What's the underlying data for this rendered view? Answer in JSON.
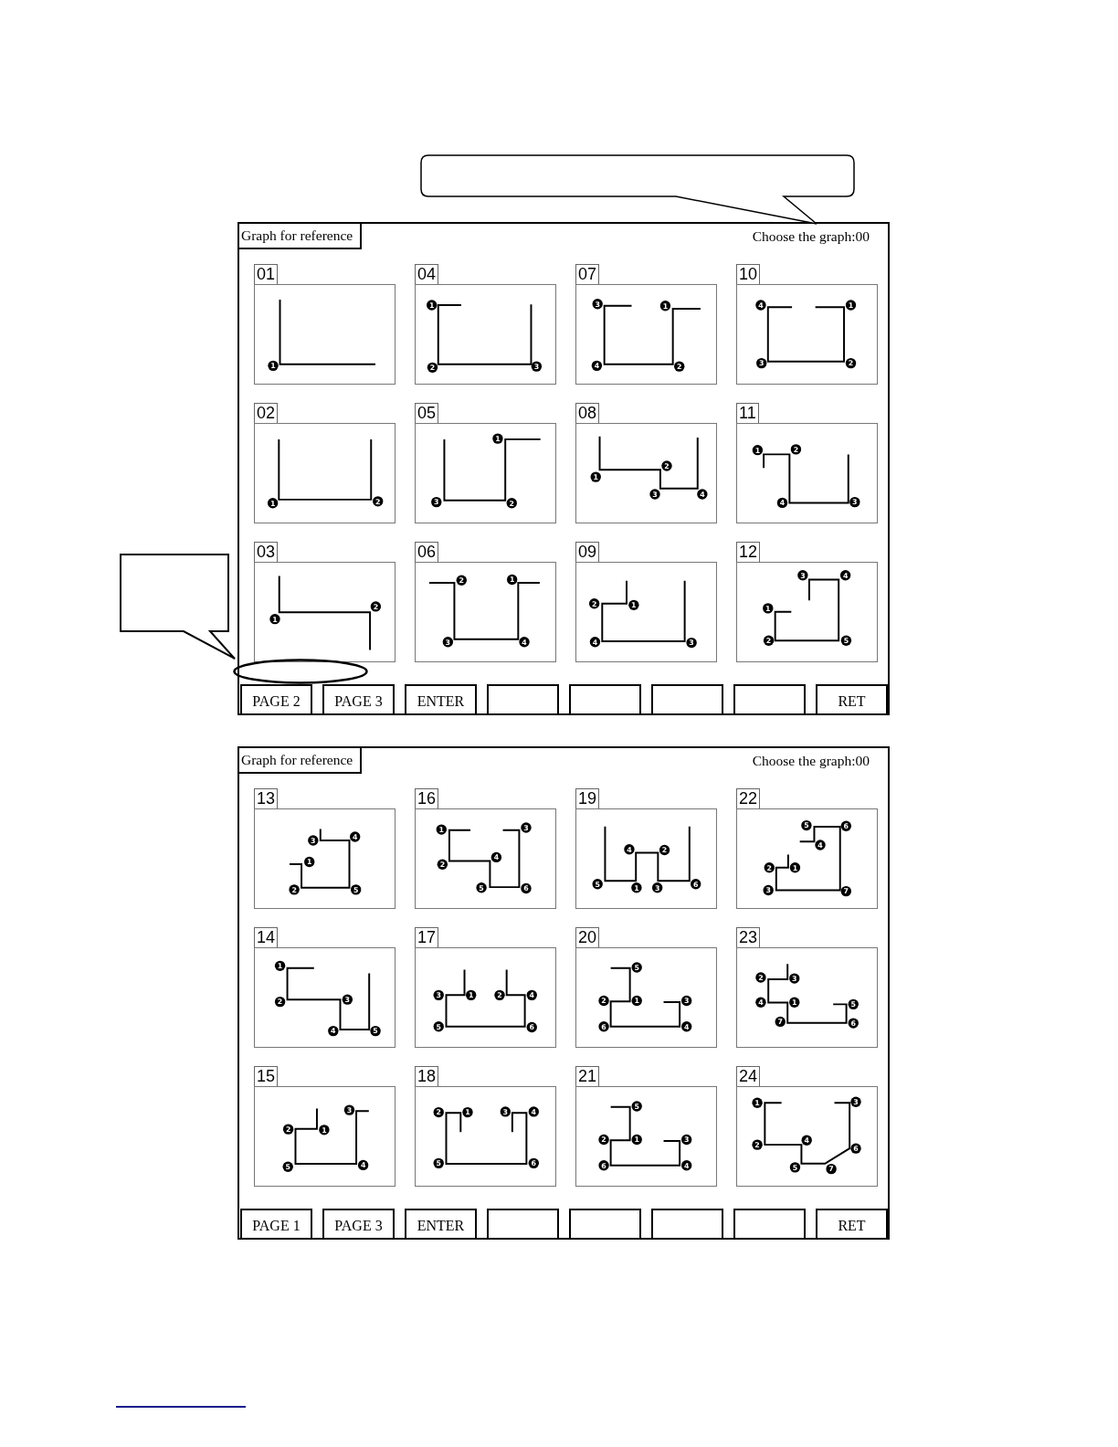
{
  "screens": [
    {
      "tab": "Graph for reference",
      "prompt": "Choose the graph:00",
      "graphs": [
        {
          "number": "01",
          "points": [
            "1"
          ]
        },
        {
          "number": "04",
          "points": [
            "1",
            "2",
            "3"
          ]
        },
        {
          "number": "07",
          "points": [
            "3",
            "1",
            "4",
            "2"
          ]
        },
        {
          "number": "10",
          "points": [
            "4",
            "1",
            "3",
            "2"
          ]
        },
        {
          "number": "02",
          "points": [
            "1",
            "2"
          ]
        },
        {
          "number": "05",
          "points": [
            "1",
            "2",
            "3"
          ]
        },
        {
          "number": "08",
          "points": [
            "1",
            "2",
            "3",
            "4"
          ]
        },
        {
          "number": "11",
          "points": [
            "1",
            "2",
            "3",
            "4"
          ]
        },
        {
          "number": "03",
          "points": [
            "1",
            "2"
          ]
        },
        {
          "number": "06",
          "points": [
            "1",
            "2",
            "3",
            "4"
          ]
        },
        {
          "number": "09",
          "points": [
            "2",
            "1",
            "4",
            "3"
          ]
        },
        {
          "number": "12",
          "points": [
            "1",
            "2",
            "3",
            "4",
            "5"
          ]
        }
      ],
      "buttons": [
        {
          "kind": "label",
          "label": "PAGE 2"
        },
        {
          "kind": "label",
          "label": "PAGE 3"
        },
        {
          "kind": "label",
          "label": "ENTER"
        },
        {
          "kind": "blank"
        },
        {
          "kind": "blank"
        },
        {
          "kind": "blank"
        },
        {
          "kind": "blank"
        },
        {
          "kind": "label",
          "label": "RET"
        }
      ]
    },
    {
      "tab": "Graph for reference",
      "prompt": "Choose the graph:00",
      "graphs": [
        {
          "number": "13",
          "points": [
            "1",
            "2",
            "3",
            "4",
            "5"
          ]
        },
        {
          "number": "16",
          "points": [
            "1",
            "2",
            "3",
            "4",
            "5",
            "6"
          ]
        },
        {
          "number": "19",
          "points": [
            "1",
            "2",
            "3",
            "4",
            "5",
            "6"
          ]
        },
        {
          "number": "22",
          "points": [
            "1",
            "2",
            "3",
            "4",
            "5",
            "6",
            "7"
          ]
        },
        {
          "number": "14",
          "points": [
            "1",
            "2",
            "3",
            "4",
            "5"
          ]
        },
        {
          "number": "17",
          "points": [
            "3",
            "1",
            "2",
            "4",
            "5",
            "6"
          ]
        },
        {
          "number": "20",
          "points": [
            "5",
            "2",
            "1",
            "3",
            "6",
            "4"
          ]
        },
        {
          "number": "23",
          "points": [
            "1",
            "2",
            "3",
            "4",
            "5",
            "6",
            "7"
          ]
        },
        {
          "number": "15",
          "points": [
            "1",
            "2",
            "3",
            "4",
            "5"
          ]
        },
        {
          "number": "18",
          "points": [
            "2",
            "1",
            "3",
            "4",
            "5",
            "6"
          ]
        },
        {
          "number": "21",
          "points": [
            "5",
            "2",
            "1",
            "3",
            "6",
            "4"
          ]
        },
        {
          "number": "24",
          "points": [
            "1",
            "2",
            "3",
            "4",
            "5",
            "6",
            "7"
          ]
        }
      ],
      "buttons": [
        {
          "kind": "label",
          "label": "PAGE 1"
        },
        {
          "kind": "label",
          "label": "PAGE 3"
        },
        {
          "kind": "label",
          "label": "ENTER"
        },
        {
          "kind": "blank"
        },
        {
          "kind": "blank"
        },
        {
          "kind": "blank"
        },
        {
          "kind": "blank"
        },
        {
          "kind": "label",
          "label": "RET"
        }
      ]
    }
  ]
}
